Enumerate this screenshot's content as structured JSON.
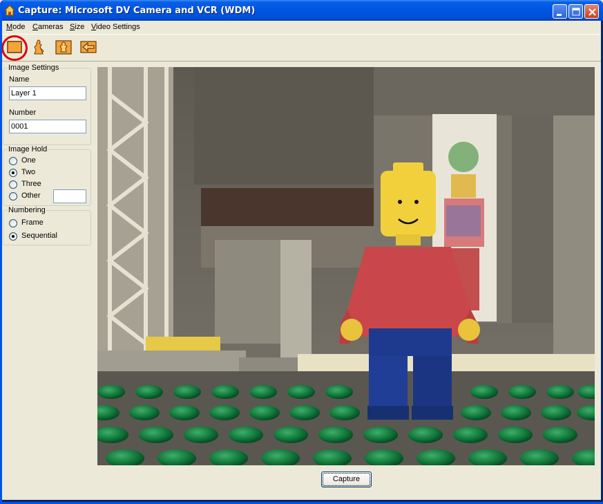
{
  "window": {
    "title": "Capture: Microsoft DV Camera and VCR (WDM)"
  },
  "menu": {
    "items": [
      {
        "underline": "M",
        "rest": "ode"
      },
      {
        "underline": "C",
        "rest": "ameras"
      },
      {
        "underline": "S",
        "rest": "ize"
      },
      {
        "underline": "V",
        "rest": "ideo Settings"
      }
    ]
  },
  "toolbar": {
    "tools": [
      "capture-frame-icon",
      "onion-skin-figure-icon",
      "figure-settings-icon",
      "back-arrow-icon"
    ],
    "accent": "#F5A33A"
  },
  "image_settings": {
    "legend": "Image Settings",
    "name_label": "Name",
    "name_value": "Layer 1",
    "number_label": "Number",
    "number_value": "0001"
  },
  "image_hold": {
    "legend": "Image Hold",
    "options": [
      "One",
      "Two",
      "Three",
      "Other"
    ],
    "selected": "Two",
    "other_value": ""
  },
  "numbering": {
    "legend": "Numbering",
    "options": [
      "Frame",
      "Sequential"
    ],
    "selected": "Sequential"
  },
  "capture_button": {
    "label": "Capture"
  },
  "colors": {
    "titlebar": "#0054E3",
    "highlight": "#E00000",
    "face": "#ECE9D8"
  }
}
